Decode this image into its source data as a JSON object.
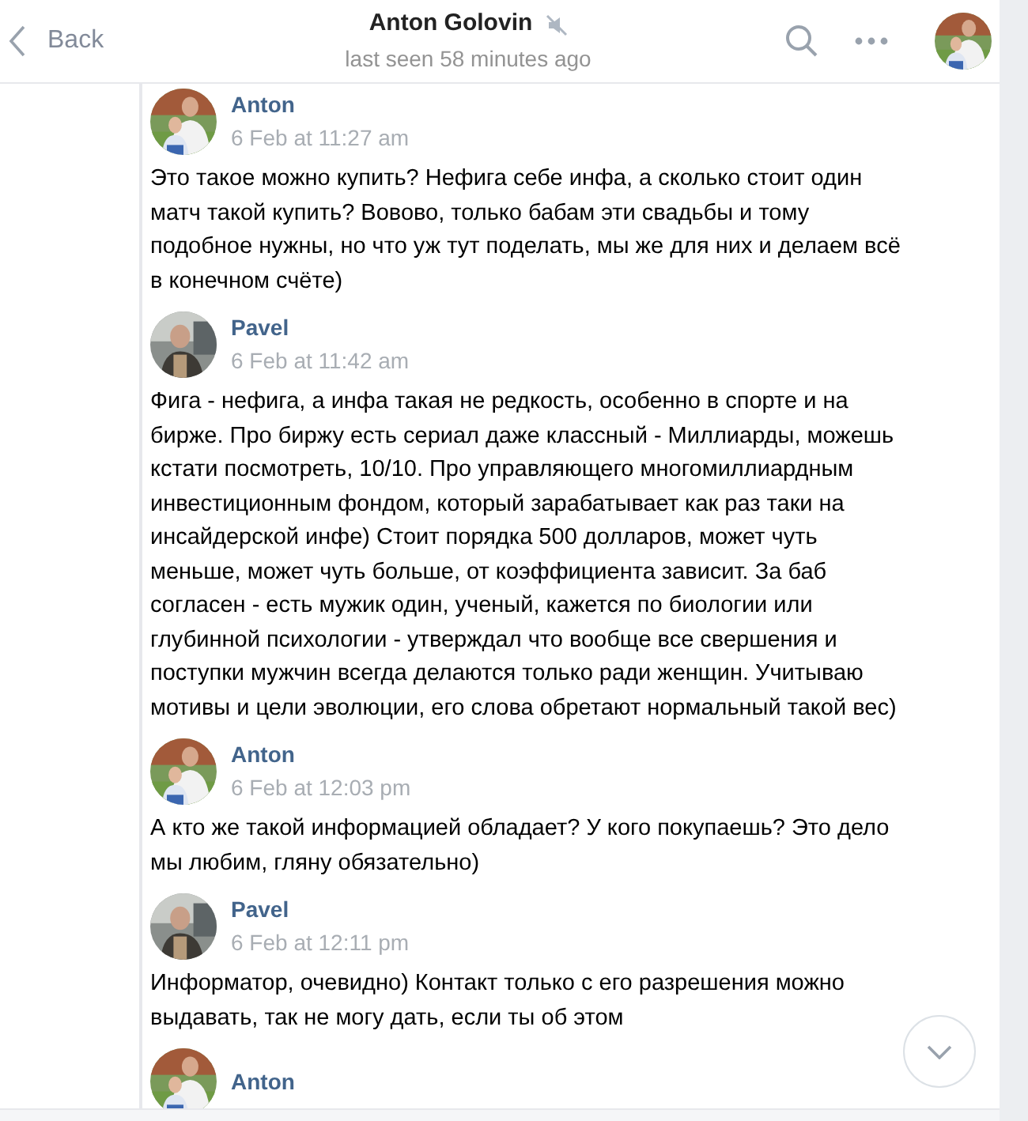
{
  "header": {
    "back_label": "Back",
    "title": "Anton Golovin",
    "muted": true,
    "subtitle": "last seen 58 minutes ago"
  },
  "messages": [
    {
      "author": "Anton",
      "kind": "anton",
      "time": "6 Feb at 11:27 am",
      "text": "Это такое можно купить? Нефига себе инфа, а сколько стоит один матч такой купить? Вовово, только бабам эти свадьбы и тому подобное нужны, но что уж тут поделать, мы же для них и делаем всё в конечном счёте)"
    },
    {
      "author": "Pavel",
      "kind": "pavel",
      "time": "6 Feb at 11:42 am",
      "text": "Фига - нефига, а инфа такая не редкость, особенно в спорте и на бирже. Про биржу есть сериал даже классный - Миллиарды, можешь кстати посмотреть, 10/10. Про управляющего многомиллиардным инвестиционным фондом, который зарабатывает как раз таки на инсайдерской инфе) Стоит порядка 500 долларов, может чуть меньше, может чуть больше, от коэффициента зависит. За баб согласен - есть мужик один, ученый, кажется по биологии или глубинной психологии - утверждал что вообще все свершения и поступки мужчин всегда делаются только ради женщин. Учитываю мотивы и цели эволюции, его слова обретают нормальный такой вес)"
    },
    {
      "author": "Anton",
      "kind": "anton",
      "time": "6 Feb at 12:03 pm",
      "text": "А кто же такой информацией обладает? У кого покупаешь? Это дело мы любим, гляну обязательно)"
    },
    {
      "author": "Pavel",
      "kind": "pavel",
      "time": "6 Feb at 12:11 pm",
      "text": "Информатор, очевидно) Контакт только с его разрешения можно выдавать, так не могу дать, если ты об этом"
    },
    {
      "author": "Anton",
      "kind": "anton"
    }
  ]
}
